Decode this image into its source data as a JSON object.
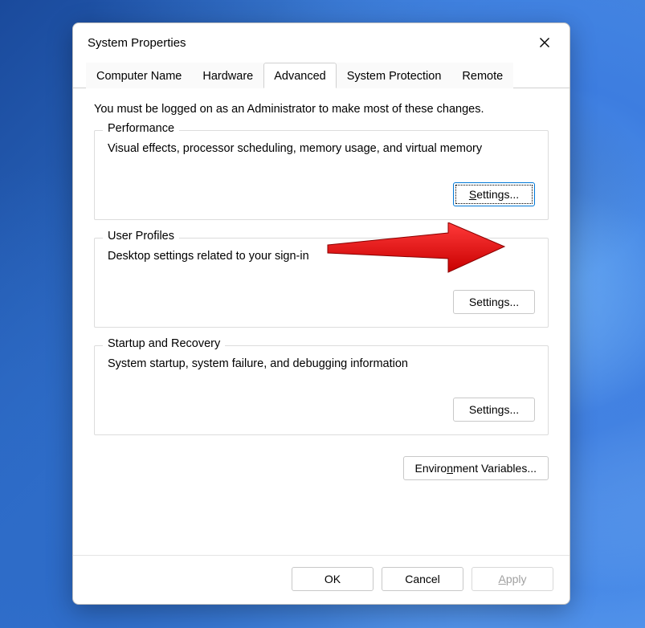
{
  "dialog": {
    "title": "System Properties"
  },
  "tabs": [
    {
      "label": "Computer Name"
    },
    {
      "label": "Hardware"
    },
    {
      "label": "Advanced"
    },
    {
      "label": "System Protection"
    },
    {
      "label": "Remote"
    }
  ],
  "content": {
    "intro": "You must be logged on as an Administrator to make most of these changes.",
    "groups": [
      {
        "legend": "Performance",
        "desc": "Visual effects, processor scheduling, memory usage, and virtual memory",
        "button": "Settings..."
      },
      {
        "legend": "User Profiles",
        "desc": "Desktop settings related to your sign-in",
        "button": "Settings..."
      },
      {
        "legend": "Startup and Recovery",
        "desc": "System startup, system failure, and debugging information",
        "button": "Settings..."
      }
    ],
    "env_button_pre": "Enviro",
    "env_button_u": "n",
    "env_button_post": "ment Variables..."
  },
  "buttons": {
    "ok": "OK",
    "cancel": "Cancel",
    "apply_u": "A",
    "apply_post": "pply"
  }
}
